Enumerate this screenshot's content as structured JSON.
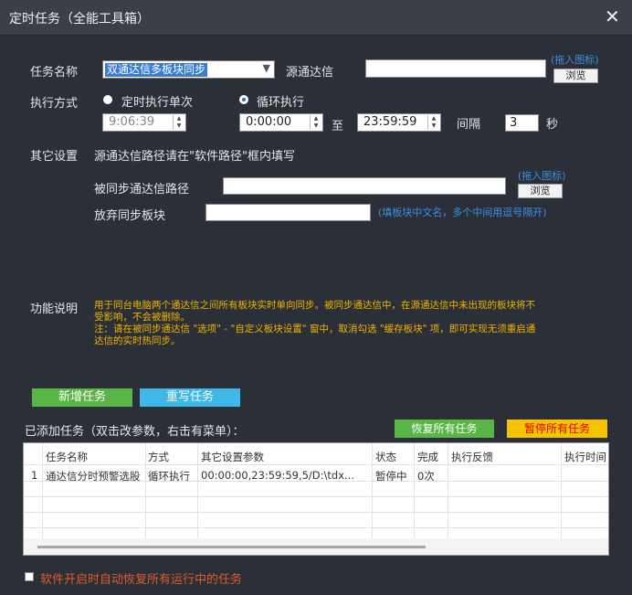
{
  "window": {
    "title": "定时任务（全能工具箱）",
    "close_glyph": "✕"
  },
  "form": {
    "task_name_label": "任务名称",
    "task_name_value": "双通达信多板块同步",
    "source_label": "源通达信",
    "source_value": "",
    "drag_icon_hint": "(拖入图标)",
    "browse_label": "浏览",
    "exec_mode_label": "执行方式",
    "once_label": "定时执行单次",
    "loop_label": "循环执行",
    "once_time": "9:06:39",
    "loop_start": "0:00:00",
    "to_label": "至",
    "loop_end": "23:59:59",
    "interval_label": "间隔",
    "interval_value": "3",
    "sec_label": "秒",
    "other_settings_label": "其它设置",
    "other_settings_desc": "源通达信路径请在\"软件路径\"框内填写",
    "synced_path_label": "被同步通达信路径",
    "synced_path_value": "",
    "drag_icon_hint2": "(拖入图标)",
    "browse_label2": "浏览",
    "abandon_label": "放弃同步板块",
    "abandon_value": "",
    "abandon_hint": "(填板块中文名，多个中间用逗号隔开)",
    "func_desc_label": "功能说明",
    "func_desc_line1": "用于同台电脑两个通达信之间所有板块实时单向同步。被同步通达信中，在源通达信中未出现的板块将不",
    "func_desc_line2": "受影响，不会被删除。",
    "func_desc_line3": "注：请在被同步通达信 \"选项\" - \"自定义板块设置\" 窗中，取消勾选 \"缓存板块\" 项，即可实现无须重启通",
    "func_desc_line4": "达信的实时热同步。"
  },
  "actions": {
    "add_task": "新增任务",
    "rewrite_task": "重写任务",
    "restore_all": "恢复所有任务",
    "pause_all": "暂停所有任务",
    "list_title": "已添加任务（双击改参数，右击有菜单）："
  },
  "table": {
    "headers": [
      "",
      "任务名称",
      "方式",
      "其它设置参数",
      "状态",
      "完成",
      "执行反馈",
      "执行时间"
    ],
    "rows": [
      [
        "1",
        "通达信分时预警选股",
        "循环执行",
        "00:00:00,23:59:59,5/D:\\tdx...",
        "暂停中",
        "0次",
        "",
        ""
      ]
    ]
  },
  "footer": {
    "auto_restore_label": "软件开启时自动恢复所有运行中的任务"
  },
  "colors": {
    "bg": "#2b2f38",
    "note": "#f0b400",
    "link": "#3f8fe8",
    "add_btn": "#58b646",
    "rewrite_btn": "#3db8e8",
    "restore_btn": "#58b646",
    "pause_btn": "#f5c300",
    "footer_text": "#e05a2c"
  }
}
